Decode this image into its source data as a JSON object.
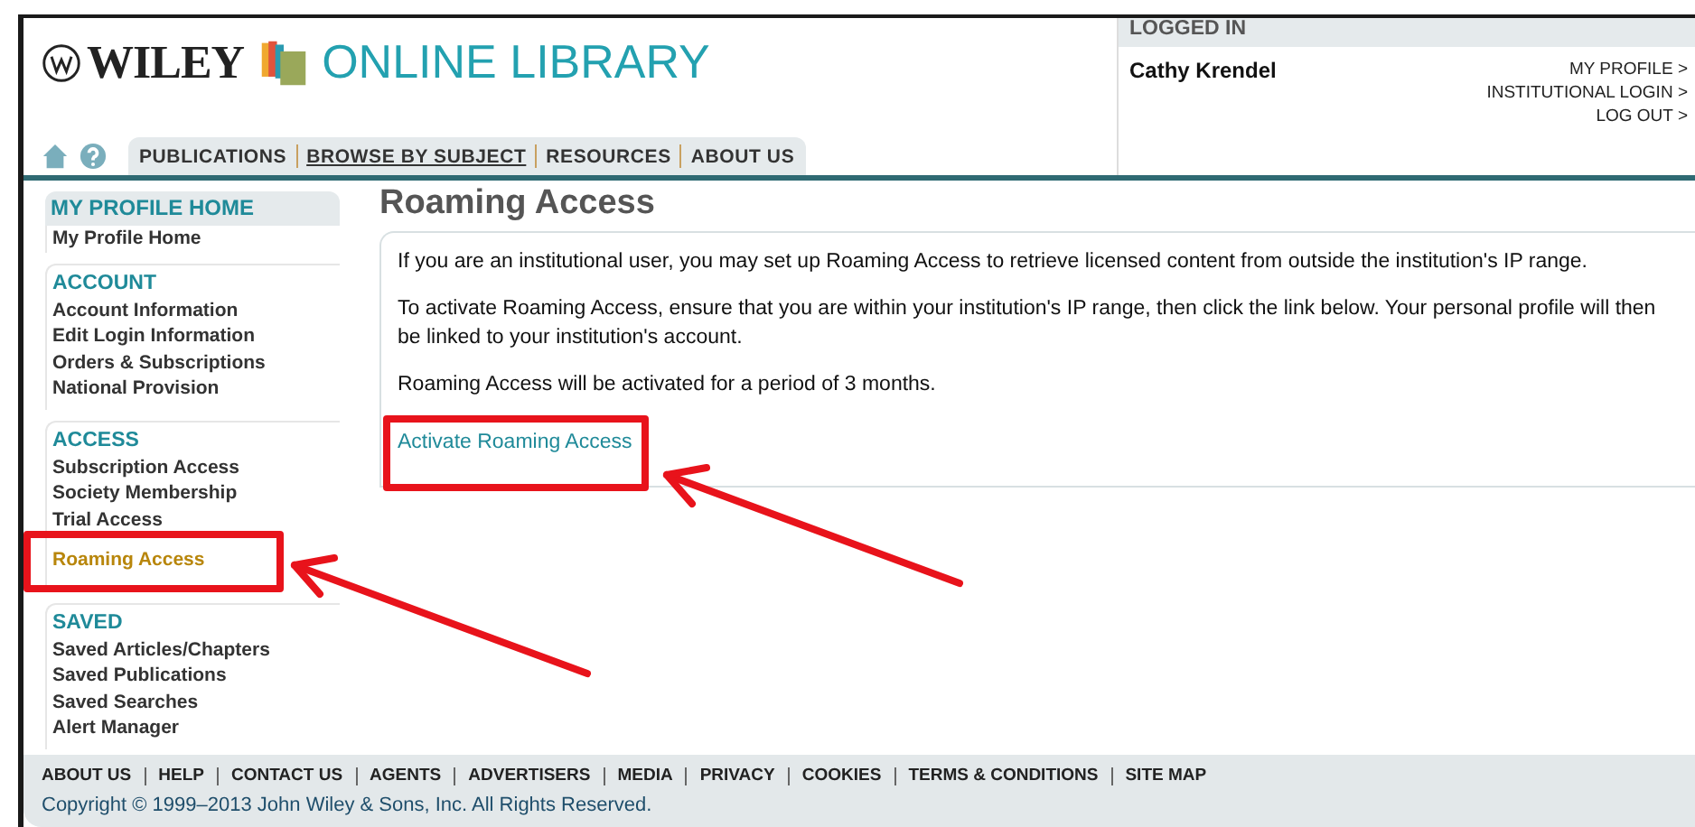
{
  "header": {
    "brand": "WILEY",
    "library": "ONLINE LIBRARY",
    "nav": [
      {
        "label": "PUBLICATIONS",
        "selected": false
      },
      {
        "label": "BROWSE BY SUBJECT",
        "selected": true
      },
      {
        "label": "RESOURCES",
        "selected": false
      },
      {
        "label": "ABOUT US",
        "selected": false
      }
    ]
  },
  "login": {
    "heading": "LOGGED IN",
    "user": "Cathy Krendel",
    "links": [
      "MY PROFILE >",
      "INSTITUTIONAL LOGIN >",
      "LOG OUT >"
    ]
  },
  "sidebar": [
    {
      "heading": "MY PROFILE HOME",
      "items": [
        {
          "label": "My Profile Home",
          "selected": false
        }
      ]
    },
    {
      "heading": "ACCOUNT",
      "items": [
        {
          "label": "Account Information",
          "selected": false
        },
        {
          "label": "Edit Login Information",
          "selected": false
        },
        {
          "label": "Orders & Subscriptions",
          "selected": false
        },
        {
          "label": "National Provision",
          "selected": false
        }
      ]
    },
    {
      "heading": "ACCESS",
      "items": [
        {
          "label": "Subscription Access",
          "selected": false
        },
        {
          "label": "Society Membership",
          "selected": false
        },
        {
          "label": "Trial Access",
          "selected": false
        },
        {
          "label": "Roaming Access",
          "selected": true
        }
      ]
    },
    {
      "heading": "SAVED",
      "items": [
        {
          "label": "Saved Articles/Chapters",
          "selected": false
        },
        {
          "label": "Saved Publications",
          "selected": false
        },
        {
          "label": "Saved Searches",
          "selected": false
        },
        {
          "label": "Alert Manager",
          "selected": false
        }
      ]
    }
  ],
  "main": {
    "title": "Roaming Access",
    "paragraphs": [
      "If you are an institutional user, you may set up Roaming Access to retrieve licensed content from outside the institution's IP range.",
      "To activate Roaming Access, ensure that you are within your institution's IP range, then click the link below. Your personal profile will then be linked to your institution's account.",
      "Roaming Access will be activated for a period of 3 months."
    ],
    "link": "Activate Roaming Access"
  },
  "footer": {
    "links": [
      "ABOUT US",
      "HELP",
      "CONTACT US",
      "AGENTS",
      "ADVERTISERS",
      "MEDIA",
      "PRIVACY",
      "COOKIES",
      "TERMS & CONDITIONS",
      "SITE MAP"
    ],
    "copyright": "Copyright © 1999–2013 John Wiley & Sons, Inc. All Rights Reserved."
  }
}
